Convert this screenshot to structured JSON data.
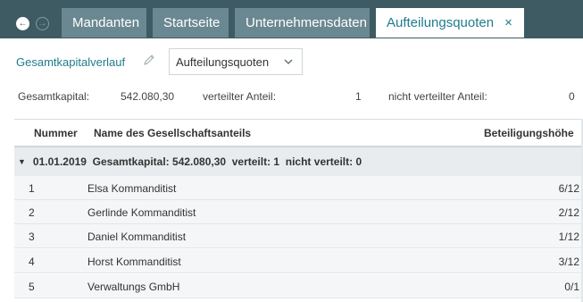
{
  "tabs": {
    "items": [
      {
        "label": "Mandanten"
      },
      {
        "label": "Startseite"
      },
      {
        "label": "Unternehmensdaten"
      },
      {
        "label": "Aufteilungsquoten"
      }
    ],
    "close_symbol": "×"
  },
  "nav": {
    "back_icon": "arrow-left-icon",
    "forward_icon": "arrow-right-icon"
  },
  "toolbar": {
    "title_link": "Gesamtkapitalverlauf",
    "edit_icon": "pencil-icon",
    "view_select": {
      "value": "Aufteilungsquoten"
    }
  },
  "summary": {
    "gesamtkapital_label": "Gesamtkapital:",
    "gesamtkapital_value": "542.080,30",
    "verteilt_label": "verteilter Anteil:",
    "verteilt_value": "1",
    "nicht_verteilt_label": "nicht verteilter Anteil:",
    "nicht_verteilt_value": "0"
  },
  "table": {
    "headers": {
      "nummer": "Nummer",
      "name": "Name des Gesellschaftsanteils",
      "beteiligung": "Beteiligungshöhe"
    },
    "group": {
      "text": "01.01.2019  Gesamtkapital: 542.080,30  verteilt: 1  nicht verteilt: 0"
    },
    "rows": [
      {
        "nummer": "1",
        "name": "Elsa Kommanditist",
        "quote": "6/12"
      },
      {
        "nummer": "2",
        "name": "Gerlinde Kommanditist",
        "quote": "2/12"
      },
      {
        "nummer": "3",
        "name": "Daniel Kommanditist",
        "quote": "1/12"
      },
      {
        "nummer": "4",
        "name": "Horst Kommanditist",
        "quote": "3/12"
      },
      {
        "nummer": "5",
        "name": "Verwaltungs GmbH",
        "quote": "0/1"
      }
    ]
  },
  "colors": {
    "tabbar": "#3e5b64",
    "tab_inactive": "#6a8891",
    "accent": "#1f7c8c",
    "group_row": "#e8ecee",
    "row_bg": "#f4f6f7"
  }
}
